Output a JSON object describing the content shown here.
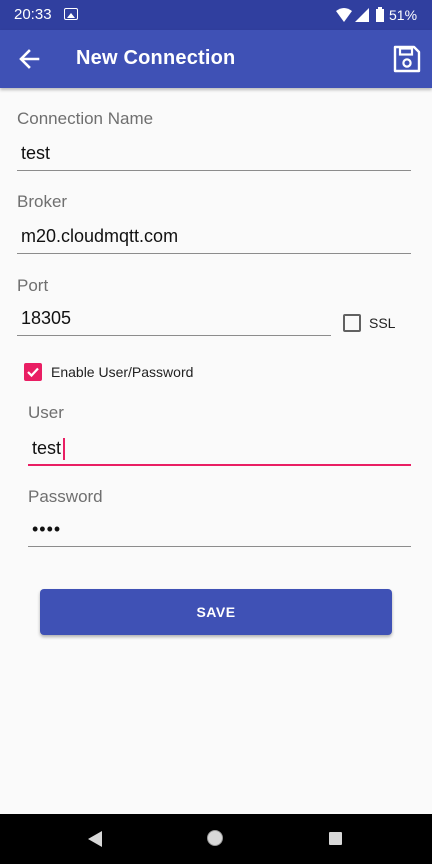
{
  "status_bar": {
    "time": "20:33",
    "battery_pct": "51%"
  },
  "app_bar": {
    "title": "New Connection"
  },
  "form": {
    "connection_name": {
      "label": "Connection Name",
      "value": "test"
    },
    "broker": {
      "label": "Broker",
      "value": "m20.cloudmqtt.com"
    },
    "port": {
      "label": "Port",
      "value": "18305"
    },
    "ssl": {
      "label": "SSL",
      "checked": false
    },
    "enable_auth": {
      "label": "Enable User/Password",
      "checked": true
    },
    "user": {
      "label": "User",
      "value": "test"
    },
    "password": {
      "label": "Password",
      "value": "••••"
    },
    "save_label": "SAVE"
  },
  "colors": {
    "primary": "#3f51b5",
    "primary_dark": "#303f9f",
    "accent": "#e91e63"
  }
}
